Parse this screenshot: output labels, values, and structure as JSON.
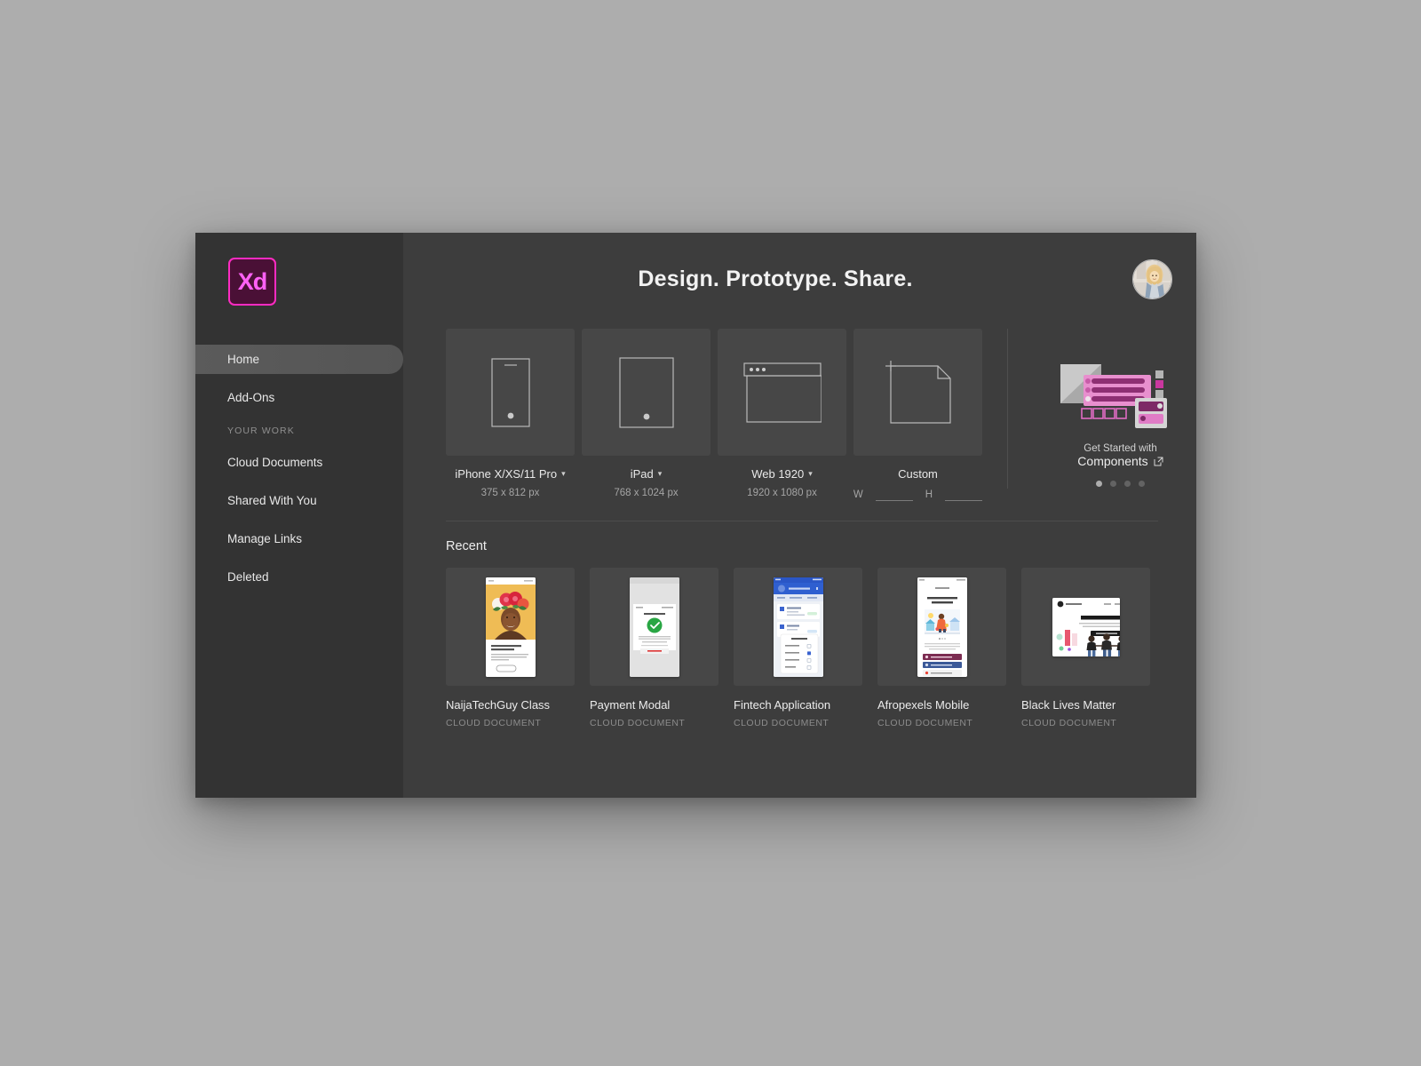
{
  "app": {
    "name": "Adobe XD",
    "logo_text": "Xd",
    "logo_border_color": "#ff2bc2",
    "logo_fill_color": "#4a1036",
    "logo_glyph_color": "#ff61f6",
    "window_bg": "#3d3d3d",
    "sidebar_bg": "#333333",
    "desktop_bg": "#adadad"
  },
  "header": {
    "title": "Design. Prototype. Share.",
    "avatar_name": "user-avatar"
  },
  "sidebar": {
    "items": [
      {
        "label": "Home",
        "active": true
      },
      {
        "label": "Add-Ons",
        "active": false
      }
    ],
    "section_label": "YOUR WORK",
    "work_items": [
      {
        "label": "Cloud Documents"
      },
      {
        "label": "Shared With You"
      },
      {
        "label": "Manage Links"
      },
      {
        "label": "Deleted"
      }
    ]
  },
  "presets": [
    {
      "name": "iPhone X/XS/11 Pro",
      "size": "375 x 812 px",
      "icon": "phone-icon",
      "has_caret": true
    },
    {
      "name": "iPad",
      "size": "768 x 1024 px",
      "icon": "tablet-icon",
      "has_caret": true
    },
    {
      "name": "Web 1920",
      "size": "1920 x 1080 px",
      "icon": "browser-window-icon",
      "has_caret": true
    },
    {
      "name": "Custom",
      "size": "",
      "icon": "custom-artboard-icon",
      "has_caret": false
    }
  ],
  "custom": {
    "width_label": "W",
    "height_label": "H",
    "width_value": "",
    "height_value": "",
    "width_placeholder": "",
    "height_placeholder": ""
  },
  "promo": {
    "caption_top": "Get Started with",
    "caption_bottom": "Components",
    "link_icon": "external-link-icon",
    "dots_total": 4,
    "dot_active_index": 0,
    "accent_color": "#e060bb"
  },
  "recent": {
    "heading": "Recent",
    "items": [
      {
        "name": "NaijaTechGuy Class",
        "type": "CLOUD DOCUMENT",
        "thumb": "flower-crown-portrait"
      },
      {
        "name": "Payment Modal",
        "type": "CLOUD DOCUMENT",
        "thumb": "payment-success-modal"
      },
      {
        "name": "Fintech Application",
        "type": "CLOUD DOCUMENT",
        "thumb": "fintech-transactions-screen"
      },
      {
        "name": "Afropexels Mobile",
        "type": "CLOUD DOCUMENT",
        "thumb": "afropexels-onboarding"
      },
      {
        "name": "Black Lives Matter",
        "type": "CLOUD DOCUMENT",
        "thumb": "blm-landing-page"
      }
    ]
  }
}
